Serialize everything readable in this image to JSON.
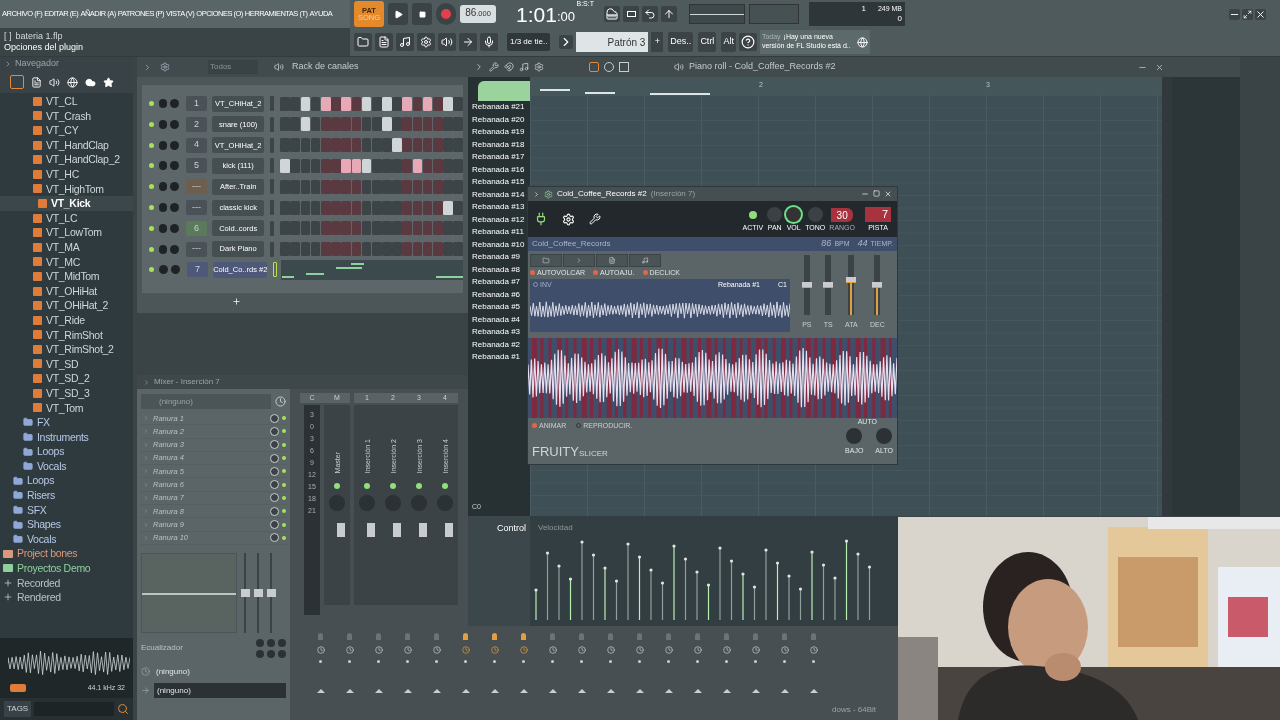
{
  "menu": [
    "ARCHIVO (F)",
    "EDITAR (E)",
    "AÑADIR (A)",
    "PATRONES (P)",
    "VISTA (V)",
    "OPCIONES (O)",
    "HERRAMIENTAS (T)",
    "AYUDA"
  ],
  "hint": {
    "bracket": "[ ]",
    "file": "bateria 1.flp",
    "text": "Opciones del plugin"
  },
  "transport": {
    "modes": [
      {
        "label": "PAT",
        "selected": true
      },
      {
        "label": "SONG",
        "selected": false
      }
    ],
    "recording": true,
    "tempo": "86",
    "tempo_fraction": ".000",
    "time": "1:01",
    "time_ticks": ":00",
    "time_unit": "B:S:T"
  },
  "monitor": {
    "cpu": "1",
    "memory": "249 MB",
    "polyphony": "0"
  },
  "toolbar": {
    "snap": "1/3 de tie..",
    "pattern": "Patrón 3",
    "add": "+",
    "keys": [
      "Des..",
      "Ctrl",
      "Alt"
    ],
    "news_day": "Today",
    "news_lines": [
      "¡Hay una nueva",
      "versión de FL Studio está d.."
    ]
  },
  "browser": {
    "title": "Navegador",
    "tree": [
      {
        "children": [
          {
            "children": [
              {
                "children": [
                  {
                    "label": "VT_CL",
                    "kind": "sample",
                    "selected": false
                  },
                  {
                    "label": "VT_Crash",
                    "kind": "sample",
                    "selected": false
                  },
                  {
                    "label": "VT_CY",
                    "kind": "sample",
                    "selected": false
                  },
                  {
                    "label": "VT_HandClap",
                    "kind": "sample",
                    "selected": false
                  },
                  {
                    "label": "VT_HandClap_2",
                    "kind": "sample",
                    "selected": false
                  },
                  {
                    "label": "VT_HC",
                    "kind": "sample",
                    "selected": false
                  },
                  {
                    "label": "VT_HighTom",
                    "kind": "sample",
                    "selected": false
                  },
                  {
                    "label": "VT_Kick",
                    "kind": "sample",
                    "selected": true
                  },
                  {
                    "label": "VT_LC",
                    "kind": "sample",
                    "selected": false
                  },
                  {
                    "label": "VT_LowTom",
                    "kind": "sample",
                    "selected": false
                  },
                  {
                    "label": "VT_MA",
                    "kind": "sample",
                    "selected": false
                  },
                  {
                    "label": "VT_MC",
                    "kind": "sample",
                    "selected": false
                  },
                  {
                    "label": "VT_MidTom",
                    "kind": "sample",
                    "selected": false
                  },
                  {
                    "label": "VT_OHiHat",
                    "kind": "sample",
                    "selected": false
                  },
                  {
                    "label": "VT_OHiHat_2",
                    "kind": "sample",
                    "selected": false
                  },
                  {
                    "label": "VT_Ride",
                    "kind": "sample",
                    "selected": false
                  },
                  {
                    "label": "VT_RimShot",
                    "kind": "sample",
                    "selected": false
                  },
                  {
                    "label": "VT_RimShot_2",
                    "kind": "sample",
                    "selected": false
                  },
                  {
                    "label": "VT_SD",
                    "kind": "sample",
                    "selected": false
                  },
                  {
                    "label": "VT_SD_2",
                    "kind": "sample",
                    "selected": false
                  },
                  {
                    "label": "VT_SD_3",
                    "kind": "sample",
                    "selected": false
                  },
                  {
                    "label": "VT_Tom",
                    "kind": "sample",
                    "selected": false
                  }
                ]
              },
              {
                "label": "FX",
                "kind": "folder"
              },
              {
                "label": "Instruments",
                "kind": "folder"
              },
              {
                "label": "Loops",
                "kind": "folder"
              },
              {
                "label": "Vocals",
                "kind": "folder"
              }
            ]
          },
          {
            "label": "Loops",
            "kind": "folder"
          },
          {
            "label": "Risers",
            "kind": "folder"
          },
          {
            "label": "SFX",
            "kind": "folder"
          },
          {
            "label": "Shapes",
            "kind": "folder"
          },
          {
            "label": "Vocals",
            "kind": "folder"
          }
        ]
      },
      {
        "label": "Project bones",
        "kind": "project",
        "color": "#d99a7c"
      },
      {
        "label": "Proyectos Demo",
        "kind": "project",
        "color": "#8fd19e"
      },
      {
        "label": "Recorded",
        "kind": "recorded"
      },
      {
        "label": "Rendered",
        "kind": "recorded"
      }
    ],
    "sample_rate": "44.1 kHz 32",
    "tags": "TAGS"
  },
  "channel_rack": {
    "title": "Rack de canales",
    "filter": "Todos",
    "channels": [
      {
        "number": "1",
        "name": "VT_CHiHat_2",
        "color": "#4b5257",
        "selected": false,
        "kind": "steps",
        "steps": [
          false,
          false,
          true,
          false,
          true,
          false,
          true,
          false,
          true,
          false,
          true,
          false,
          true,
          false,
          true,
          false,
          true,
          false
        ]
      },
      {
        "number": "2",
        "name": "snare (100)",
        "color": "#4b5257",
        "selected": false,
        "kind": "steps",
        "steps": [
          false,
          false,
          true,
          false,
          false,
          false,
          false,
          false,
          false,
          false,
          true,
          false,
          false,
          false,
          false,
          false,
          false,
          false
        ]
      },
      {
        "number": "4",
        "name": "VT_OHiHat_2",
        "color": "#4b5257",
        "selected": false,
        "kind": "steps",
        "steps": [
          false,
          false,
          false,
          false,
          false,
          false,
          false,
          false,
          false,
          false,
          false,
          true,
          false,
          false,
          false,
          false,
          false,
          false
        ]
      },
      {
        "number": "5",
        "name": "kick (111)",
        "color": "#4b5257",
        "selected": false,
        "kind": "steps",
        "steps": [
          true,
          false,
          false,
          false,
          false,
          false,
          true,
          true,
          true,
          false,
          false,
          false,
          false,
          true,
          false,
          false,
          false,
          false
        ]
      },
      {
        "number": "---",
        "name": "After..Train",
        "color": "#6e5e4e",
        "selected": false,
        "kind": "steps",
        "steps": [
          false,
          false,
          false,
          false,
          false,
          false,
          false,
          false,
          false,
          false,
          false,
          false,
          false,
          false,
          false,
          false,
          false,
          false
        ]
      },
      {
        "number": "---",
        "name": "classic kick",
        "color": "#4b5257",
        "selected": false,
        "kind": "steps",
        "steps": [
          false,
          false,
          false,
          false,
          false,
          false,
          false,
          false,
          false,
          false,
          false,
          false,
          false,
          false,
          false,
          false,
          true,
          false
        ]
      },
      {
        "number": "6",
        "name": "Cold..cords",
        "color": "#5b7a5c",
        "selected": false,
        "kind": "steps",
        "steps": [
          false,
          false,
          false,
          false,
          false,
          false,
          false,
          false,
          false,
          false,
          false,
          false,
          false,
          false,
          false,
          false,
          false,
          false
        ]
      },
      {
        "number": "---",
        "name": "Dark Piano",
        "color": "#4b5257",
        "selected": false,
        "kind": "steps",
        "steps": [
          false,
          false,
          false,
          false,
          false,
          false,
          false,
          false,
          false,
          false,
          false,
          false,
          false,
          false,
          false,
          false,
          false,
          false
        ]
      },
      {
        "number": "7",
        "name": "Cold_Co..rds #2",
        "color": "#4e5878",
        "selected": true,
        "kind": "notes"
      }
    ]
  },
  "piano_roll": {
    "title": "Piano roll - Cold_Coffee_Records #2",
    "bars": [
      "2",
      "3"
    ],
    "slices": [
      "Rebanada #21",
      "Rebanada #20",
      "Rebanada #19",
      "Rebanada #18",
      "Rebanada #17",
      "Rebanada #16",
      "Rebanada #15",
      "Rebanada #14",
      "Rebanada #13",
      "Rebanada #12",
      "Rebanada #11",
      "Rebanada #10",
      "Rebanada #9",
      "Rebanada #8",
      "Rebanada #7",
      "Rebanada #6",
      "Rebanada #5",
      "Rebanada #4",
      "Rebanada #3",
      "Rebanada #2",
      "Rebanada #1"
    ]
  },
  "slicer": {
    "title": "Cold_Coffee_Records #2",
    "insert": "(Inserción 7)",
    "active": true,
    "knobs": [
      "ACTIV",
      "PAN",
      "VOL",
      "TONO"
    ],
    "range_value": "30",
    "range_label": "RANGO",
    "track_value": "7",
    "track_label": "PISTA",
    "sample": "Cold_Coffee_Records",
    "bpm": "86",
    "bpm_unit": "BPM",
    "beats": "44",
    "beats_unit": "TIEMP.",
    "toggles": [
      {
        "label": "AUTOVOLCAR",
        "on": true
      },
      {
        "label": "AUTOAJU.",
        "on": true
      },
      {
        "label": "DECLICK",
        "on": true
      }
    ],
    "inv": {
      "label": "INV",
      "on": false
    },
    "slice_name": "Rebanada #1",
    "slice_note": "C1",
    "sliders": [
      {
        "label": "PS",
        "level": 0.5,
        "kind": "bipolar"
      },
      {
        "label": "TS",
        "level": 0.5,
        "kind": "bipolar"
      },
      {
        "label": "ATA",
        "level": 0.58,
        "kind": "fill"
      },
      {
        "label": "DEC",
        "level": 0.5,
        "kind": "fill"
      }
    ],
    "play_toggles": [
      {
        "label": "ANIMAR",
        "on": true
      },
      {
        "label": "REPRODUCIR.",
        "on": false
      }
    ],
    "auto": "AUTO",
    "eq_knobs": [
      "BAJO",
      "ALTO"
    ],
    "brand": "FRUITY",
    "brand_sub": "SLICER"
  },
  "mixer": {
    "title": "Mixer - Inserción 7",
    "effect_slot": "(ninguno)",
    "slots": [
      {
        "label": "Ranura 1",
        "on": true
      },
      {
        "label": "Ranura 2",
        "on": true
      },
      {
        "label": "Ranura 3",
        "on": true
      },
      {
        "label": "Ranura 4",
        "on": true
      },
      {
        "label": "Ranura 5",
        "on": true
      },
      {
        "label": "Ranura 6",
        "on": true
      },
      {
        "label": "Ranura 7",
        "on": true
      },
      {
        "label": "Ranura 8",
        "on": true
      },
      {
        "label": "Ranura 9",
        "on": true
      },
      {
        "label": "Ranura 10",
        "on": true
      }
    ],
    "eq_label": "Ecualizador",
    "eq_sliders": [
      {
        "level": 0.5
      },
      {
        "level": 0.5
      },
      {
        "level": 0.5
      }
    ],
    "routes_in": "(ninguno)",
    "routes_out": "(ninguno)",
    "headers": [
      "C",
      "M",
      "1",
      "2",
      "3",
      "4"
    ],
    "scale": [
      "3",
      "0",
      "3",
      "6",
      "9",
      "12",
      "15",
      "18",
      "21"
    ],
    "strips": [
      "Master",
      "Inserción 1",
      "Inserción 2",
      "Inserción 3",
      "Inserción 4"
    ],
    "sends": [
      false,
      false,
      false,
      false,
      false,
      true,
      true,
      true,
      false,
      false,
      false,
      false,
      false,
      false,
      false,
      false,
      false,
      false
    ]
  },
  "event_editor": {
    "label": "Control",
    "faded_label": "Velocidad",
    "note": "C0"
  },
  "footer": "dows - 64Bit"
}
